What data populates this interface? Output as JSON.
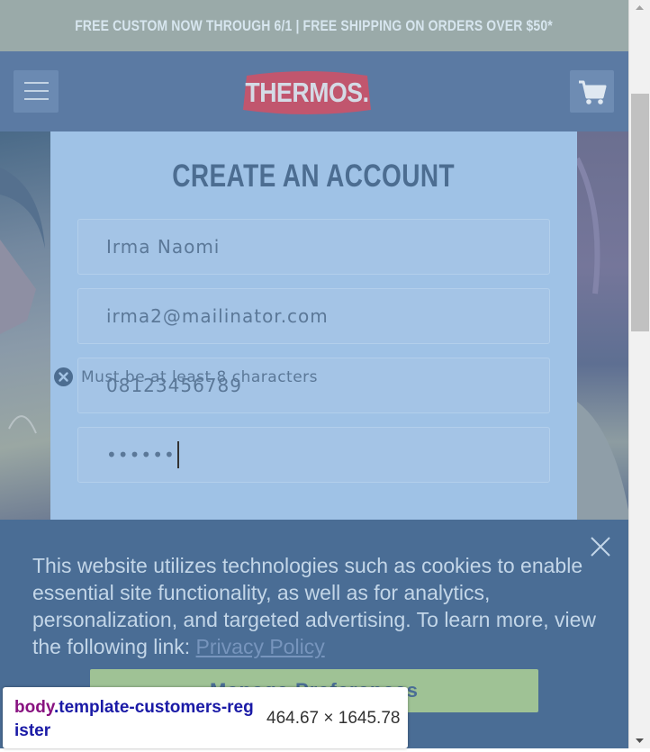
{
  "promo": {
    "text": "FREE CUSTOM NOW THROUGH 6/1 | FREE SHIPPING ON ORDERS OVER $50*"
  },
  "header": {
    "logo_text": "THERMOS.",
    "menu_icon": "hamburger-menu-icon",
    "cart_icon": "shopping-cart-icon"
  },
  "form": {
    "title": "CREATE AN ACCOUNT",
    "name_value": "Irma Naomi",
    "email_value": "irma2@mailinator.com",
    "phone_value": "08123456789",
    "password_value": "••••••",
    "password_error": "Must be at least 8 characters"
  },
  "cookie_banner": {
    "text": "This website utilizes technologies such as cookies to enable essential site functionality, as well as for analytics, personalization, and targeted advertising. To learn more, view the following link: ",
    "link_text": "Privacy Policy",
    "button_label": "Manage Preferences",
    "close_icon": "close-icon"
  },
  "devtools_tooltip": {
    "tag": "body",
    "class_name": ".template-customers-register",
    "size": "464.67 × 1645.78"
  },
  "colors": {
    "promo_bg": "#9aaaa9",
    "header_bg": "#5b7aa3",
    "card_bg": "#9fc2e6",
    "logo_red": "#c1566e",
    "cookie_bg": "#4a6d95",
    "button_green": "#9fc295"
  }
}
